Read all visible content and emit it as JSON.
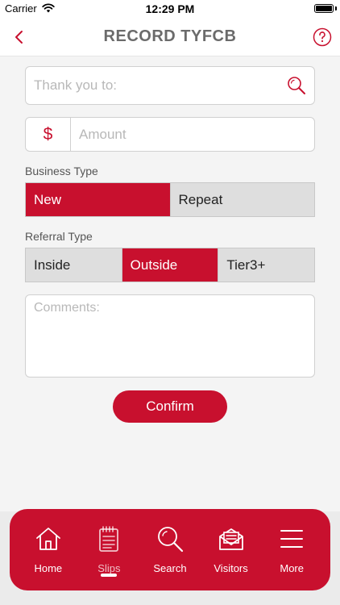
{
  "status_bar": {
    "carrier": "Carrier",
    "time": "12:29 PM"
  },
  "nav": {
    "title": "RECORD TYFCB",
    "back_icon": "chevron-left-icon",
    "help_icon": "question-circle-icon"
  },
  "form": {
    "thank_you": {
      "placeholder": "Thank you to:",
      "value": ""
    },
    "amount": {
      "currency_symbol": "$",
      "placeholder": "Amount",
      "value": ""
    },
    "business_type": {
      "label": "Business Type",
      "options": [
        "New",
        "Repeat"
      ],
      "selected": "New"
    },
    "referral_type": {
      "label": "Referral Type",
      "options": [
        "Inside",
        "Outside",
        "Tier3+"
      ],
      "selected": "Outside"
    },
    "comments": {
      "placeholder": "Comments:",
      "value": ""
    },
    "confirm_label": "Confirm"
  },
  "tabs": [
    {
      "label": "Home",
      "icon": "home-icon",
      "active": false
    },
    {
      "label": "Slips",
      "icon": "notepad-icon",
      "active": true
    },
    {
      "label": "Search",
      "icon": "search-icon",
      "active": false
    },
    {
      "label": "Visitors",
      "icon": "envelope-icon",
      "active": false
    },
    {
      "label": "More",
      "icon": "menu-icon",
      "active": false
    }
  ],
  "colors": {
    "accent": "#c8102e",
    "title_gray": "#6b6b6b",
    "background": "#f4f4f4",
    "segment_inactive": "#dedede"
  }
}
